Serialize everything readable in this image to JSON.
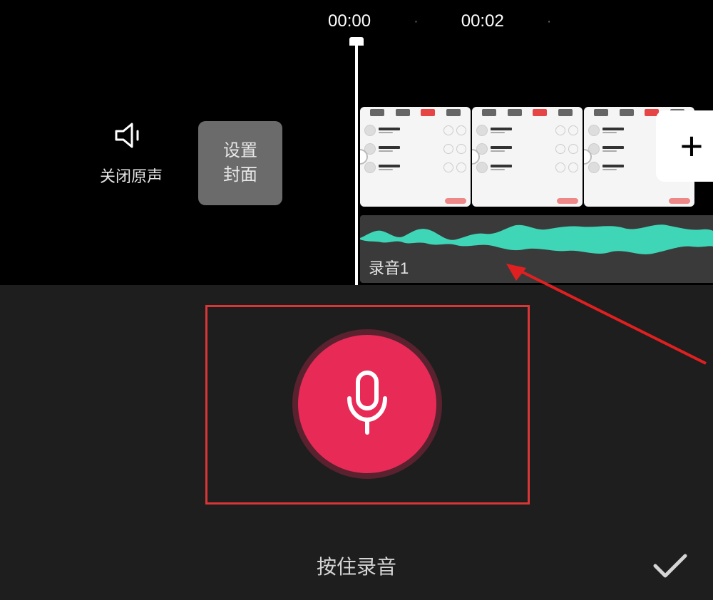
{
  "timeline": {
    "time_start": "00:00",
    "time_mid": "00:02"
  },
  "controls": {
    "mute_label": "关闭原声",
    "cover_line1": "设置",
    "cover_line2": "封面",
    "add_clip_symbol": "+"
  },
  "audio": {
    "track_label": "录音1"
  },
  "record": {
    "hint": "按住录音"
  },
  "colors": {
    "record_button": "#e82a57",
    "waveform": "#3fd6b8",
    "highlight_border": "#d93636",
    "arrow": "#e02020"
  }
}
